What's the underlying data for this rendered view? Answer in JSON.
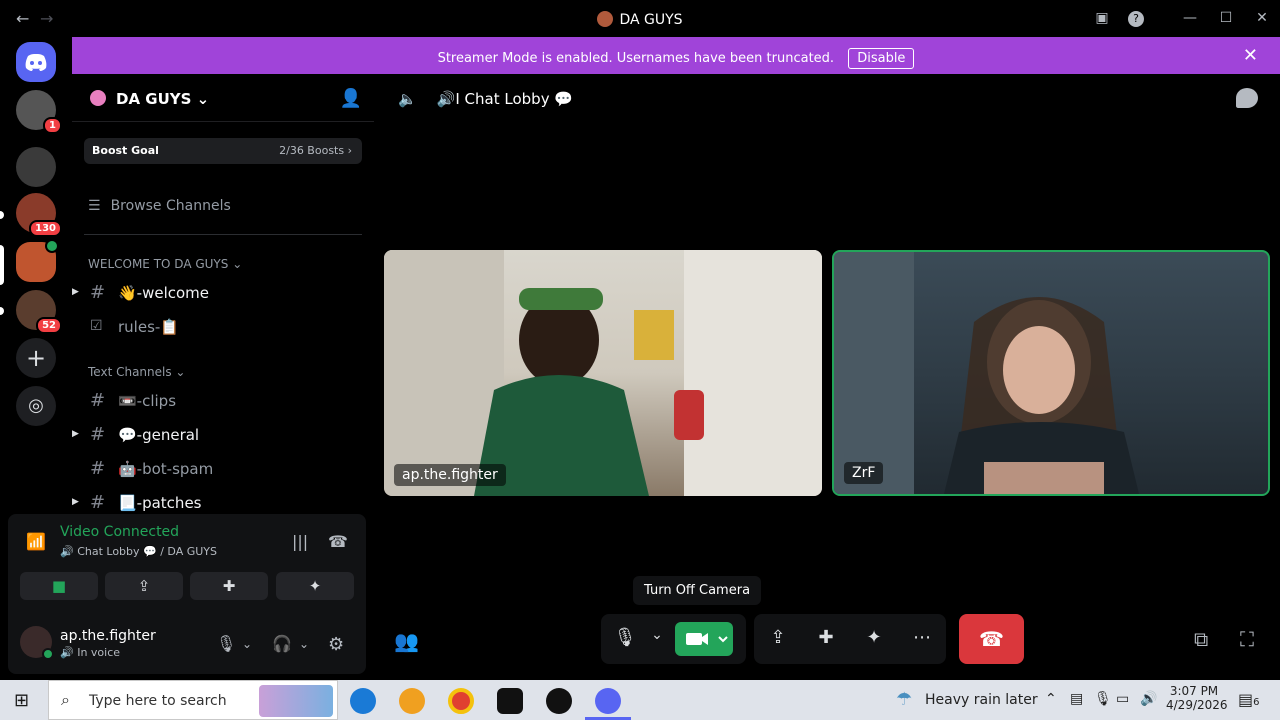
{
  "window": {
    "title": "DA GUYS",
    "back": "←",
    "forward": "→"
  },
  "banner": {
    "message": "Streamer Mode is enabled. Usernames have been truncated.",
    "disable_label": "Disable",
    "close": "✕"
  },
  "guilds": [
    {
      "name": "server-1",
      "badge": "1",
      "color": "#555555"
    },
    {
      "name": "server-2",
      "badge": "",
      "color": "#3a3a3a"
    },
    {
      "name": "server-3",
      "badge": "130",
      "color": "#8a3b2a"
    },
    {
      "name": "server-da-guys",
      "badge": "",
      "color": "#c0552f"
    },
    {
      "name": "server-5",
      "badge": "52",
      "color": "#5a3d2e"
    }
  ],
  "server": {
    "name": "DA GUYS",
    "boost_goal": "Boost Goal",
    "boost_count": "2/36 Boosts",
    "browse_channels": "Browse Channels"
  },
  "categories": {
    "welcome": "WELCOME TO DA GUYS",
    "text": "Text Channels"
  },
  "channels": {
    "welcome": "👋-welcome",
    "rules": "rules-📋",
    "clips": "📼-clips",
    "general": "💬-general",
    "bot_spam": "🤖-bot-spam",
    "patches": "📃-patches"
  },
  "voice_panel": {
    "status": "Video Connected",
    "channel": "🔊 Chat Lobby 💬 / DA GUYS"
  },
  "user": {
    "name": "ap.the.fighter",
    "status": "In voice"
  },
  "stage": {
    "channel_title": "🔊I Chat Lobby 💬",
    "tiles": [
      {
        "name": "ap.the.fighter"
      },
      {
        "name": "ZrF"
      }
    ],
    "tooltip": "Turn Off Camera"
  },
  "taskbar": {
    "search_placeholder": "Type here to search",
    "weather": "Heavy rain later",
    "time": "3:07 PM",
    "date": "4/29/2026",
    "notifications": "6"
  },
  "colors": {
    "accent_green": "#23a55a",
    "banner": "#a044d9",
    "danger": "#da373c"
  }
}
